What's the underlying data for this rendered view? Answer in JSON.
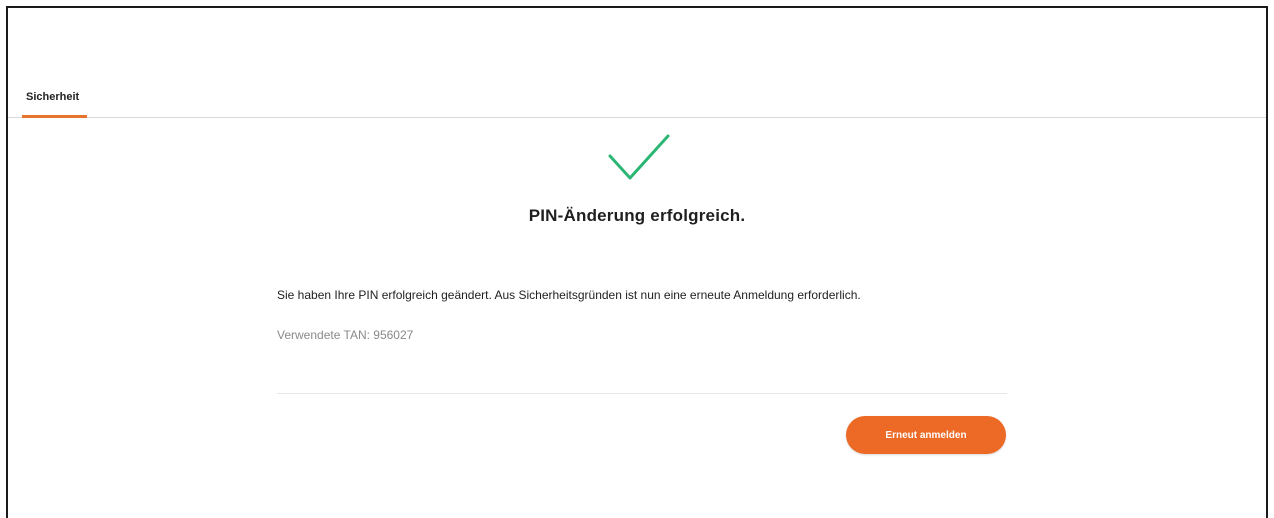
{
  "tabs": [
    {
      "label": "Sicherheit",
      "active": true
    }
  ],
  "result": {
    "icon": "checkmark-icon",
    "title": "PIN-Änderung erfolgreich.",
    "message": "Sie haben Ihre PIN erfolgreich geändert. Aus Sicherheitsgründen ist nun eine erneute Anmeldung erforderlich.",
    "tan_text": "Verwendete TAN: 956027"
  },
  "actions": {
    "relogin_label": "Erneut anmelden"
  },
  "colors": {
    "accent": "#ec6a26",
    "success": "#2bb673",
    "text": "#1f1f1f",
    "muted": "#8a8a8a"
  }
}
